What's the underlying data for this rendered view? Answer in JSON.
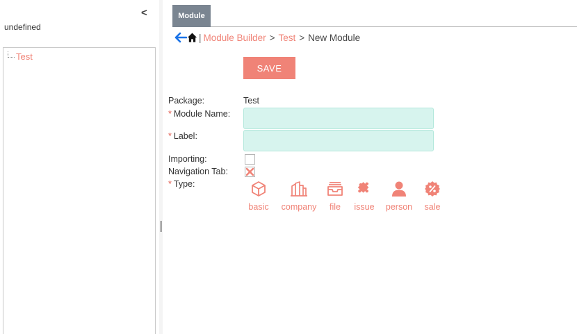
{
  "sidebar": {
    "collapse_label": "<",
    "title": "undefined",
    "tree": [
      {
        "label": "Test"
      }
    ]
  },
  "tabs": [
    {
      "label": "Module"
    }
  ],
  "breadcrumb": {
    "items": [
      {
        "label": "Module Builder"
      },
      {
        "label": "Test"
      }
    ],
    "current": "New Module",
    "separator": ">",
    "pipe": "|"
  },
  "toolbar": {
    "save_label": "SAVE"
  },
  "form": {
    "required_mark": "*",
    "package": {
      "label": "Package:",
      "value": "Test"
    },
    "module_name": {
      "label": "Module Name:",
      "value": ""
    },
    "label": {
      "label": "Label:",
      "value": ""
    },
    "importing": {
      "label": "Importing:",
      "checked": false
    },
    "navigation_tab": {
      "label": "Navigation Tab:",
      "checked": true
    },
    "type": {
      "label": "Type:",
      "options": [
        {
          "label": "basic",
          "icon": "cube-icon"
        },
        {
          "label": "company",
          "icon": "buildings-icon"
        },
        {
          "label": "file",
          "icon": "inbox-tray-icon"
        },
        {
          "label": "issue",
          "icon": "puzzle-icon"
        },
        {
          "label": "person",
          "icon": "person-icon"
        },
        {
          "label": "sale",
          "icon": "percent-badge-icon"
        }
      ]
    }
  },
  "colors": {
    "accent": "#f08377",
    "tab_bg": "#7a8591",
    "field_bg": "#d7f4ee",
    "field_border": "#b4e8dc",
    "required": "#e25b4f",
    "back_arrow": "#1a73e8"
  }
}
